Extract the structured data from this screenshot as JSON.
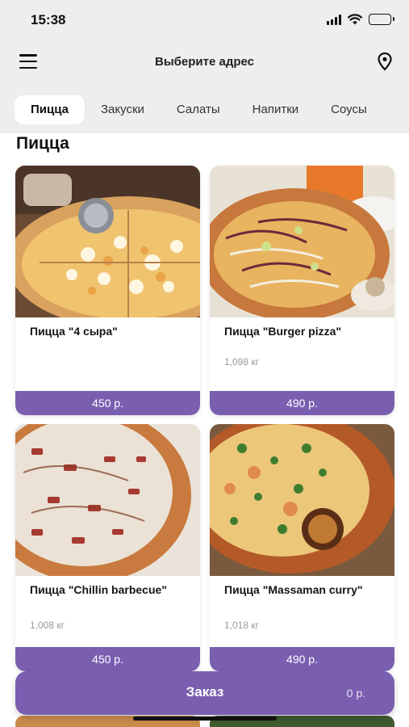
{
  "status_bar": {
    "time": "15:38"
  },
  "header": {
    "menu_icon": "hamburger-menu-icon",
    "title": "Выберите адрес",
    "location_icon": "map-pin-icon"
  },
  "tabs": [
    {
      "label": "Пицца",
      "active": true
    },
    {
      "label": "Закуски",
      "active": false
    },
    {
      "label": "Салаты",
      "active": false
    },
    {
      "label": "Напитки",
      "active": false
    },
    {
      "label": "Соусы",
      "active": false
    }
  ],
  "section_title": "Пицца",
  "products": [
    {
      "name": "Пицца \"4 сыра\"",
      "weight": "",
      "price": "450 р."
    },
    {
      "name": "Пицца \"Burger pizza\"",
      "weight": "1,098 кг",
      "price": "490 р."
    },
    {
      "name": "Пицца \"Chillin barbecue\"",
      "weight": "1,008 кг",
      "price": "450 р."
    },
    {
      "name": "Пицца \"Massaman curry\"",
      "weight": "1,018 кг",
      "price": "490 р."
    }
  ],
  "order_bar": {
    "label": "Заказ",
    "total": "0 р."
  },
  "colors": {
    "accent": "#7a5fb0",
    "header_bg": "#efeeec"
  }
}
